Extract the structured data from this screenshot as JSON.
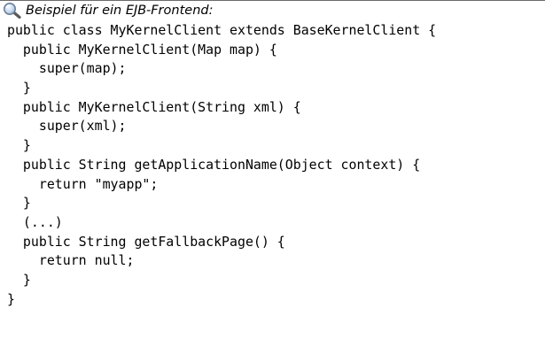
{
  "caption": {
    "icon": "magnifier-icon",
    "text": "Beispiel für ein EJB-Frontend:"
  },
  "code": {
    "language": "java",
    "lines": [
      "public class MyKernelClient extends BaseKernelClient {",
      "  public MyKernelClient(Map map) {",
      "    super(map);",
      "  }",
      "  public MyKernelClient(String xml) {",
      "    super(xml);",
      "  }",
      "  public String getApplicationName(Object context) {",
      "    return \"myapp\";",
      "  }",
      "  (...)",
      "  public String getFallbackPage() {",
      "    return null;",
      "  }",
      "}"
    ]
  }
}
